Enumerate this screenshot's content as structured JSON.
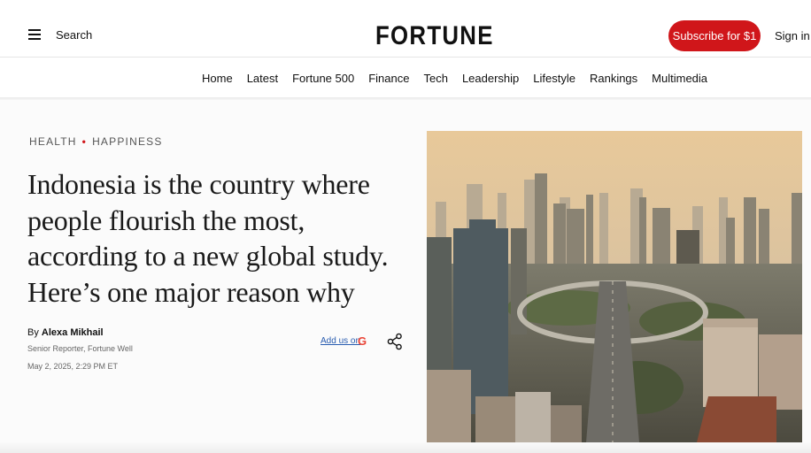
{
  "header": {
    "search_label": "Search",
    "logo_text": "FORTUNE",
    "subscribe_label": "Subscribe for $1",
    "signin_label": "Sign in"
  },
  "nav": {
    "items": [
      "Home",
      "Latest",
      "Fortune 500",
      "Finance",
      "Tech",
      "Leadership",
      "Lifestyle",
      "Rankings",
      "Multimedia"
    ]
  },
  "article": {
    "categories": [
      "HEALTH",
      "HAPPINESS"
    ],
    "headline": "Indonesia is the country where people flourish the most, according to a new global study. Here’s one major reason why",
    "by_prefix": "By",
    "author": "Alexa Mikhail",
    "author_role": "Senior Reporter, Fortune Well",
    "date": "May 2, 2025, 2:29 PM ET",
    "add_us_label": "Add us on"
  },
  "colors": {
    "brand_red": "#d0161a",
    "link_blue": "#2a5db0"
  }
}
